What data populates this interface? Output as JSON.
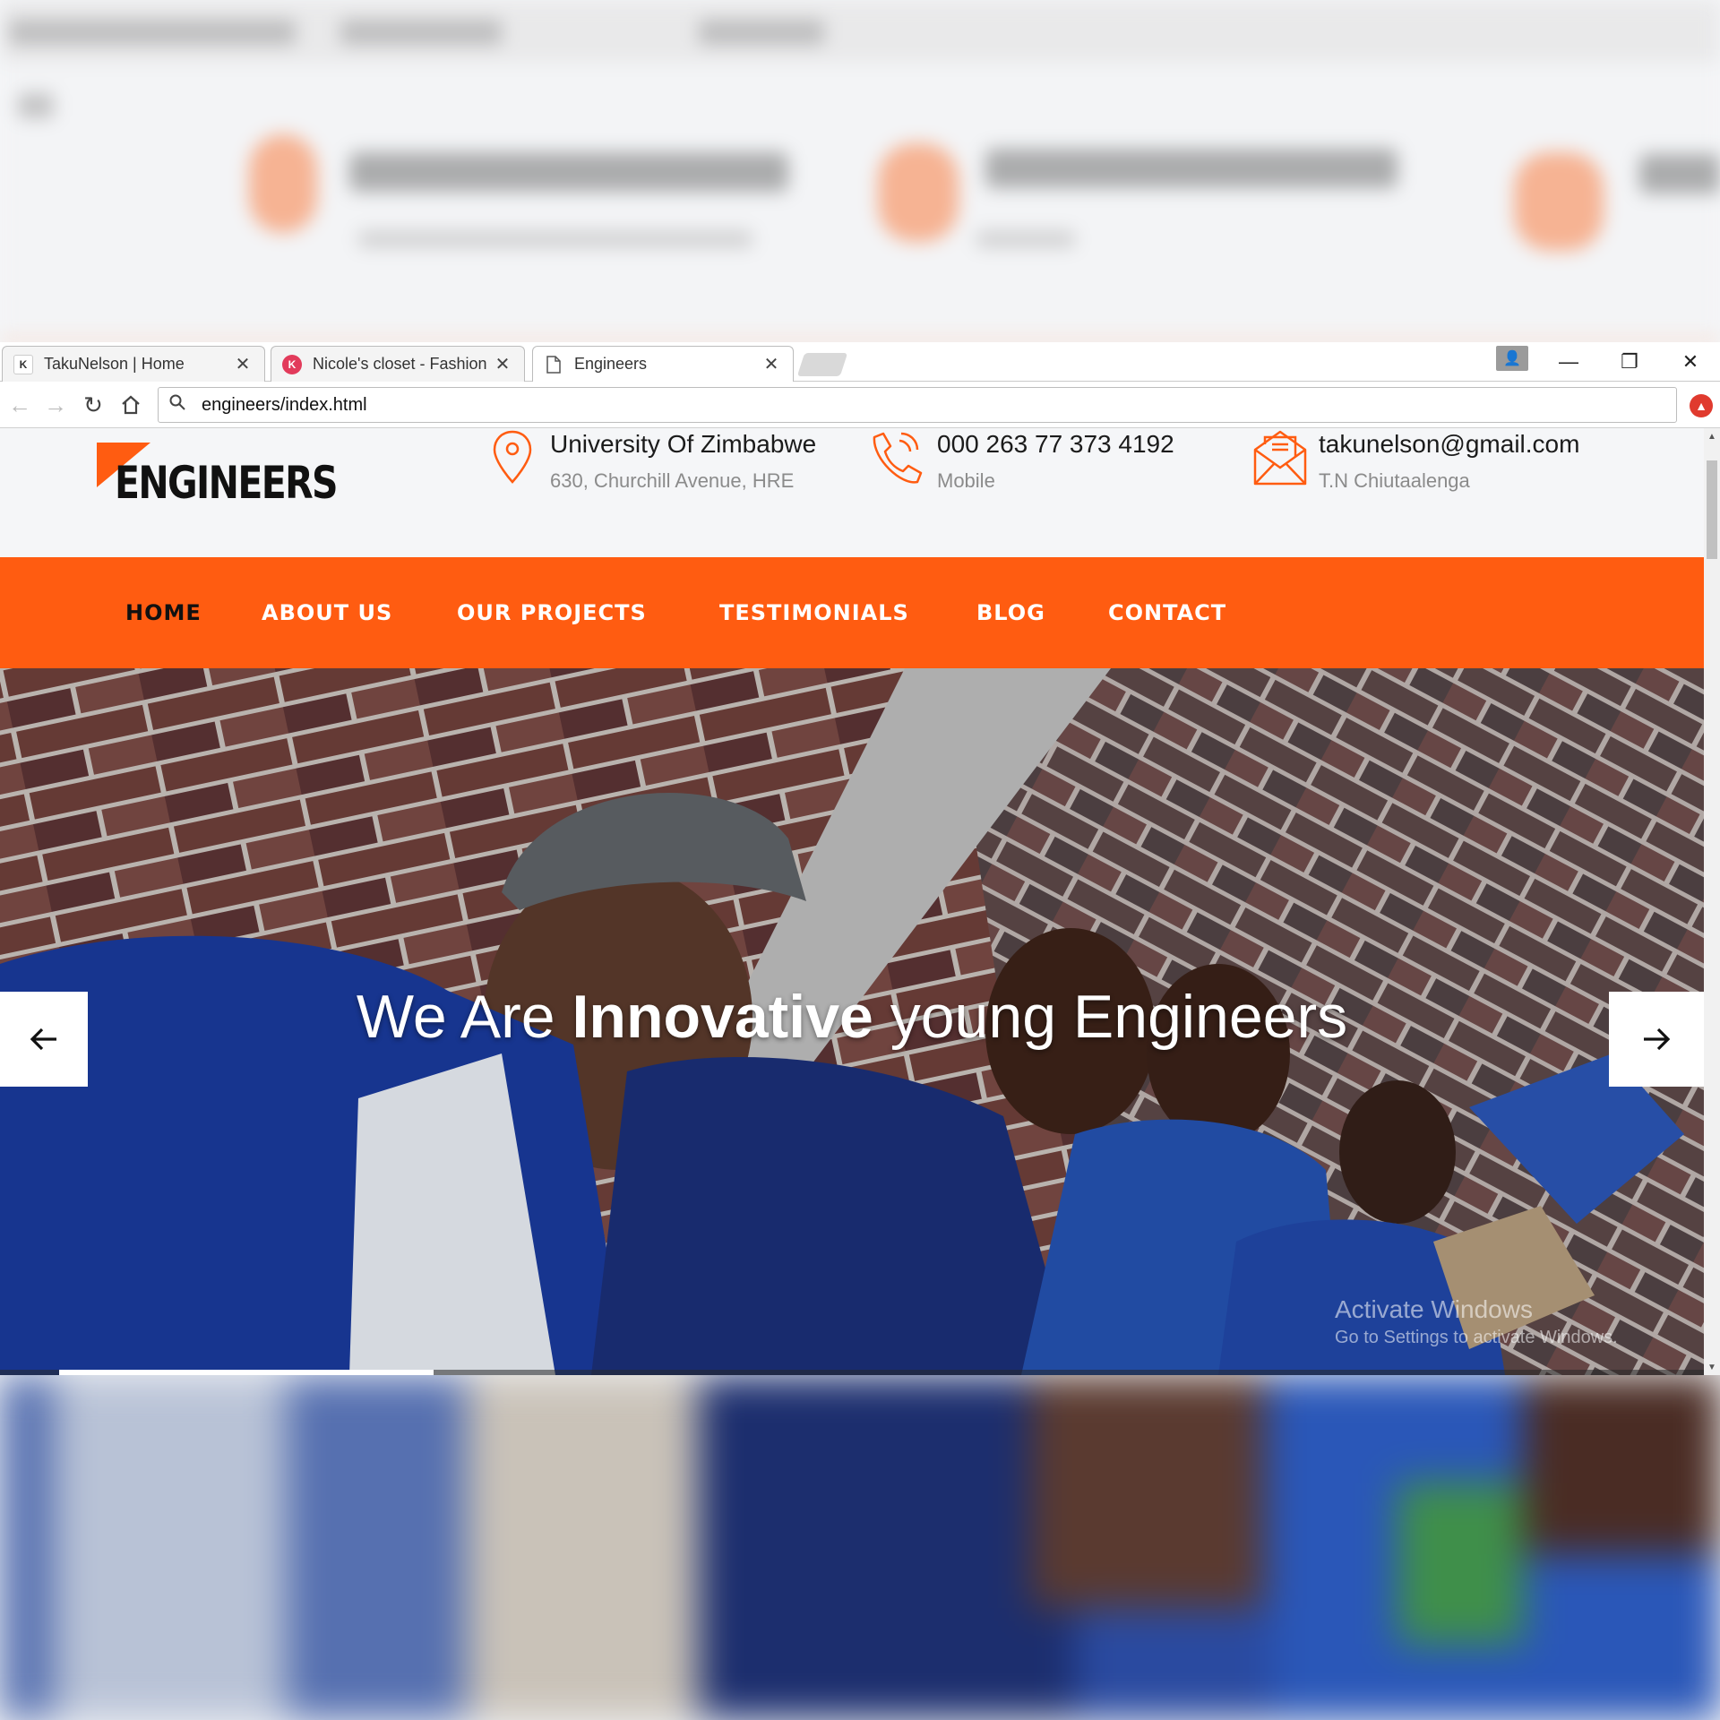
{
  "browser": {
    "tabs": [
      {
        "label": "TakuNelson | Home",
        "favicon": "TakuNelson favicon"
      },
      {
        "label": "Nicole's closet - Fashion",
        "favicon": "K"
      },
      {
        "label": "Engineers",
        "favicon": "page-icon"
      }
    ],
    "url": "engineers/index.html"
  },
  "site": {
    "logo": "ENGINEERS",
    "contacts": [
      {
        "main": "University Of Zimbabwe",
        "sub": "630, Churchill Avenue, HRE",
        "icon": "map-pin-icon"
      },
      {
        "main": "000 263 77 373 4192",
        "sub": "Mobile",
        "icon": "phone-icon"
      },
      {
        "main": "takunelson@gmail.com",
        "sub": "T.N Chiutaalenga",
        "icon": "envelope-icon"
      }
    ],
    "nav": [
      "HOME",
      "ABOUT US",
      "OUR PROJECTS",
      "TESTIMONIALS",
      "BLOG",
      "CONTACT"
    ],
    "hero": {
      "title_part1": "We Are ",
      "title_bold": "Innovative",
      "title_part2": " young Engineers",
      "slide_progress": 0.22
    },
    "watermark": {
      "line1": "Activate Windows",
      "line2": "Go to Settings to activate Windows."
    }
  },
  "colors": {
    "accent": "#ff5c11",
    "nav_active": "#111111"
  }
}
